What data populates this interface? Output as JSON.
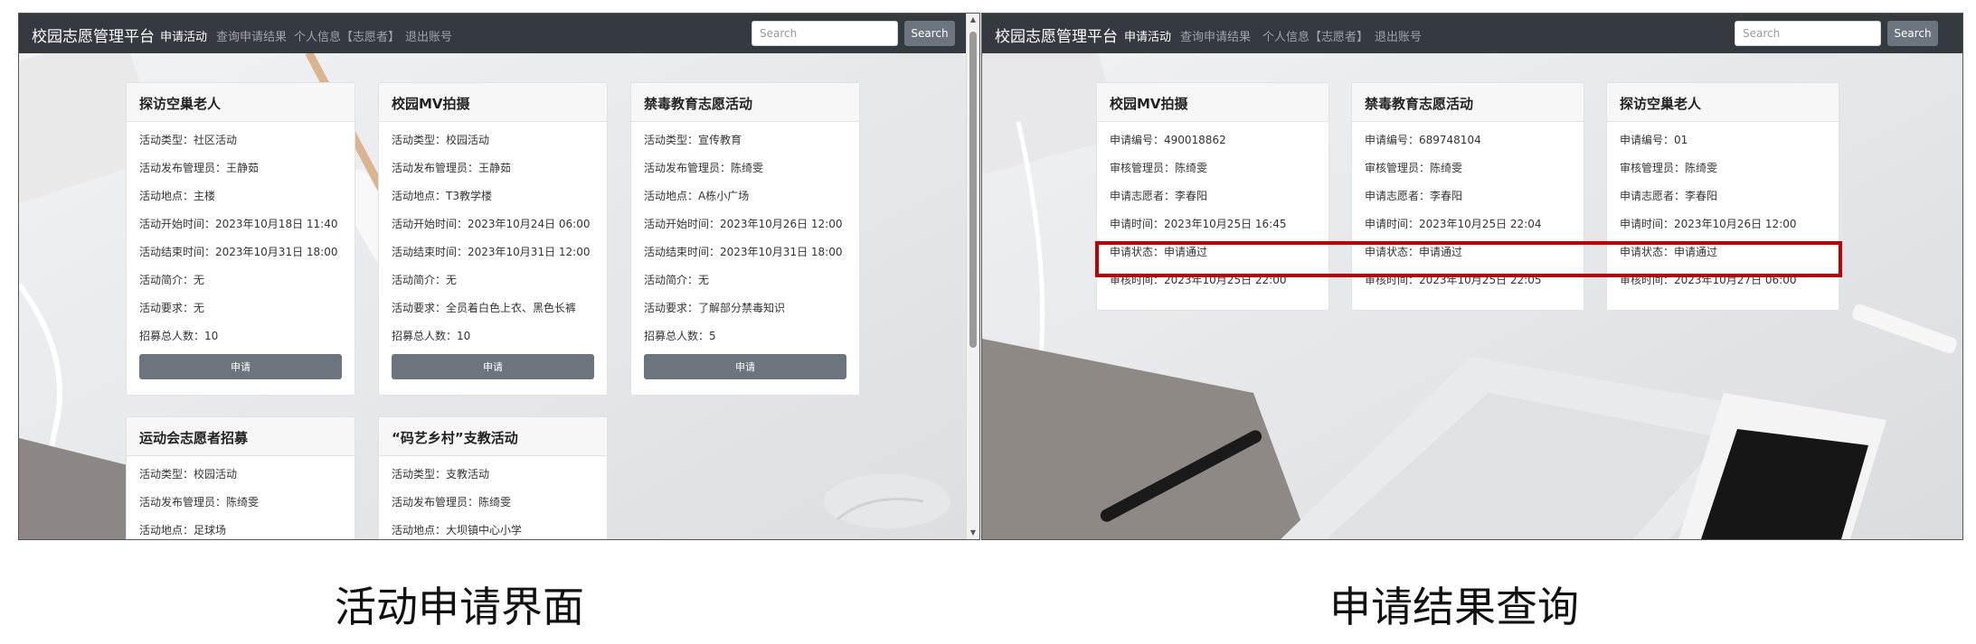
{
  "left_panel": {
    "brand": "校园志愿管理平台",
    "nav": [
      "申请活动",
      "查询申请结果",
      "个人信息【志愿者】",
      "退出账号"
    ],
    "search_placeholder": "Search",
    "search_button": "Search",
    "cards": [
      {
        "title": "探访空巢老人",
        "rows": [
          "活动类型：社区活动",
          "活动发布管理员：王静茹",
          "活动地点：主楼",
          "活动开始时间：2023年10月18日 11:40",
          "活动结束时间：2023年10月31日 18:00",
          "活动简介：无",
          "活动要求：无",
          "招募总人数：10"
        ],
        "button": "申请"
      },
      {
        "title": "校园MV拍摄",
        "rows": [
          "活动类型：校园活动",
          "活动发布管理员：王静茹",
          "活动地点：T3教学楼",
          "活动开始时间：2023年10月24日 06:00",
          "活动结束时间：2023年10月31日 12:00",
          "活动简介：无",
          "活动要求：全员着白色上衣、黑色长裤",
          "招募总人数：10"
        ],
        "button": "申请"
      },
      {
        "title": "禁毒教育志愿活动",
        "rows": [
          "活动类型：宣传教育",
          "活动发布管理员：陈绮雯",
          "活动地点：A栋小广场",
          "活动开始时间：2023年10月26日 12:00",
          "活动结束时间：2023年10月31日 18:00",
          "活动简介：无",
          "活动要求：了解部分禁毒知识",
          "招募总人数：5"
        ],
        "button": "申请"
      },
      {
        "title": "运动会志愿者招募",
        "rows": [
          "活动类型：校园活动",
          "活动发布管理员：陈绮雯",
          "活动地点：足球场"
        ]
      },
      {
        "title": "“码艺乡村”支教活动",
        "rows": [
          "活动类型：支教活动",
          "活动发布管理员：陈绮雯",
          "活动地点：大坝镇中心小学"
        ]
      }
    ]
  },
  "right_panel": {
    "brand": "校园志愿管理平台",
    "nav": [
      "申请活动",
      "查询申请结果",
      "个人信息【志愿者】",
      "退出账号"
    ],
    "search_placeholder": "Search",
    "search_button": "Search",
    "cards": [
      {
        "title": "校园MV拍摄",
        "rows": [
          "申请编号：490018862",
          "审核管理员：陈绮雯",
          "申请志愿者：李春阳",
          "申请时间：2023年10月25日 16:45",
          "申请状态：申请通过",
          "审核时间：2023年10月25日 22:00"
        ]
      },
      {
        "title": "禁毒教育志愿活动",
        "rows": [
          "申请编号：689748104",
          "审核管理员：陈绮雯",
          "申请志愿者：李春阳",
          "申请时间：2023年10月25日 22:04",
          "申请状态：申请通过",
          "审核时间：2023年10月25日 22:05"
        ]
      },
      {
        "title": "探访空巢老人",
        "rows": [
          "申请编号：01",
          "审核管理员：陈绮雯",
          "申请志愿者：李春阳",
          "申请时间：2023年10月26日 12:00",
          "申请状态：申请通过",
          "审核时间：2023年10月27日 06:00"
        ]
      }
    ]
  },
  "captions": {
    "left": "活动申请界面",
    "right": "申请结果查询"
  },
  "colors": {
    "navbar": "#343a40",
    "button": "#6c757d",
    "highlight": "#c00000"
  }
}
